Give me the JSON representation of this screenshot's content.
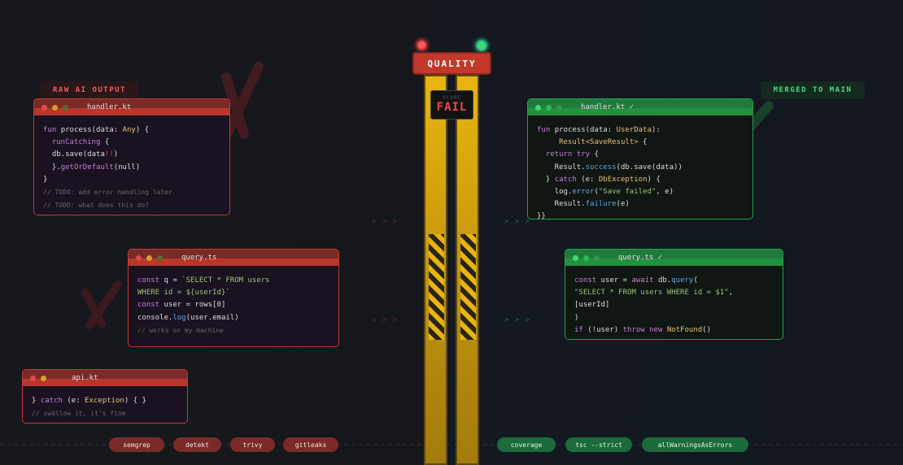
{
  "left": {
    "label": "RAW AI OUTPUT",
    "windows": [
      {
        "title": "handler.kt",
        "lines": [
          [
            [
              "fun ",
              "k"
            ],
            [
              "process(data: ",
              "p"
            ],
            [
              "Any",
              "t"
            ],
            [
              ") {",
              "p"
            ]
          ],
          [
            [
              "  runCatching ",
              "k"
            ],
            [
              "{",
              "p"
            ]
          ],
          [
            [
              "  db.save(data",
              "p"
            ],
            [
              "!!",
              "e"
            ],
            [
              ")",
              "p"
            ]
          ],
          [
            [
              "  }.",
              "p"
            ],
            [
              "getOrDefault",
              "k"
            ],
            [
              "(null)",
              "p"
            ]
          ],
          [
            [
              "}",
              "p"
            ]
          ],
          [
            [
              "// TODO: add error handling later",
              "c"
            ]
          ],
          [
            [
              "// TODO: what does this do?",
              "c"
            ]
          ]
        ]
      },
      {
        "title": "query.ts",
        "lines": [
          [
            [
              "const ",
              "k"
            ],
            [
              "q = ",
              "p"
            ],
            [
              "`SELECT * FROM users",
              "s"
            ]
          ],
          [
            [
              "WHERE id = ${userId}`",
              "s"
            ]
          ],
          [
            [
              "const ",
              "k"
            ],
            [
              "user = rows[0]",
              "p"
            ]
          ],
          [
            [
              "console.",
              "p"
            ],
            [
              "log",
              "f"
            ],
            [
              "(user.email)",
              "p"
            ]
          ],
          [
            [
              "// works on my machine",
              "c"
            ]
          ]
        ]
      },
      {
        "title": "api.kt",
        "lines": [
          [
            [
              "} ",
              "p"
            ],
            [
              "catch ",
              "k"
            ],
            [
              "(e: ",
              "p"
            ],
            [
              "Exception",
              "t"
            ],
            [
              ") { }",
              "p"
            ]
          ],
          [
            [
              "// swallow it, it's fine",
              "c"
            ]
          ]
        ]
      }
    ],
    "checks": [
      "semgrep",
      "detekt",
      "trivy",
      "gitleaks"
    ]
  },
  "right": {
    "label": "MERGED TO MAIN",
    "windows": [
      {
        "title": "handler.kt ✓",
        "lines": [
          [
            [
              "fun ",
              "k"
            ],
            [
              "process(data: ",
              "p"
            ],
            [
              "UserData",
              "t"
            ],
            [
              "):",
              "p"
            ]
          ],
          [
            [
              "     Result<SaveResult>",
              "t"
            ],
            [
              " {",
              "p"
            ]
          ],
          [
            [
              "  return try ",
              "k"
            ],
            [
              "{",
              "p"
            ]
          ],
          [
            [
              "    Result.",
              "p"
            ],
            [
              "success",
              "f"
            ],
            [
              "(db.save(data))",
              "p"
            ]
          ],
          [
            [
              "  } ",
              "p"
            ],
            [
              "catch ",
              "k"
            ],
            [
              "(e: ",
              "p"
            ],
            [
              "DbException",
              "t"
            ],
            [
              ") {",
              "p"
            ]
          ],
          [
            [
              "    log.",
              "p"
            ],
            [
              "error",
              "f"
            ],
            [
              "(",
              "p"
            ],
            [
              "\"Save failed\"",
              "s"
            ],
            [
              ", e)",
              "p"
            ]
          ],
          [
            [
              "    Result.",
              "p"
            ],
            [
              "failure",
              "f"
            ],
            [
              "(e)",
              "p"
            ]
          ],
          [
            [
              "}}",
              "p"
            ]
          ]
        ]
      },
      {
        "title": "query.ts ✓",
        "lines": [
          [
            [
              "const ",
              "k"
            ],
            [
              "user = ",
              "p"
            ],
            [
              "await ",
              "k"
            ],
            [
              "db.",
              "p"
            ],
            [
              "query",
              "f"
            ],
            [
              "(",
              "p"
            ]
          ],
          [
            [
              "\"SELECT * FROM users WHERE id = $1\"",
              "s"
            ],
            [
              ",",
              "p"
            ]
          ],
          [
            [
              "[userId]",
              "p"
            ]
          ],
          [
            [
              ")",
              "p"
            ]
          ],
          [
            [
              "if ",
              "k"
            ],
            [
              "(!user) ",
              "p"
            ],
            [
              "throw new ",
              "k"
            ],
            [
              "NotFound",
              "t"
            ],
            [
              "()",
              "p"
            ]
          ]
        ]
      }
    ],
    "checks": [
      "coverage",
      "tsc --strict",
      "allWarningsAsErrors"
    ]
  },
  "gate": {
    "title": "QUALITY",
    "score_label": "SCORE",
    "score_value": "FAIL"
  },
  "arrow": "> > >",
  "colors": {
    "fail": "#c0392b",
    "pass": "#22a04a",
    "gate": "#e8b50e"
  }
}
